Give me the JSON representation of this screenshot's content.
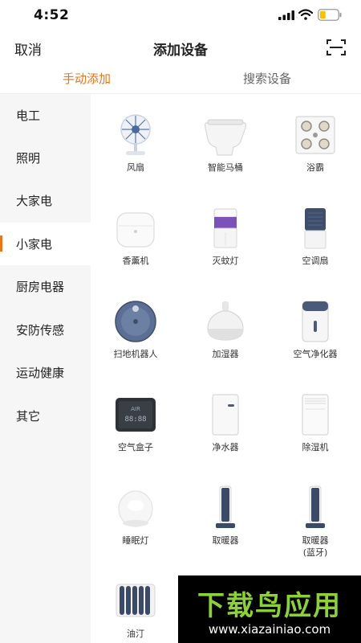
{
  "status_bar": {
    "time": "4:52"
  },
  "nav": {
    "cancel": "取消",
    "title": "添加设备",
    "scan_icon": "scan-icon"
  },
  "tabs": [
    {
      "label": "手动添加",
      "active": true
    },
    {
      "label": "搜索设备",
      "active": false
    }
  ],
  "accent_color": "#e8751a",
  "sidebar": {
    "items": [
      {
        "label": "电工",
        "active": false
      },
      {
        "label": "照明",
        "active": false
      },
      {
        "label": "大家电",
        "active": false
      },
      {
        "label": "小家电",
        "active": true
      },
      {
        "label": "厨房电器",
        "active": false
      },
      {
        "label": "安防传感",
        "active": false
      },
      {
        "label": "运动健康",
        "active": false
      },
      {
        "label": "其它",
        "active": false
      }
    ]
  },
  "devices": [
    {
      "label": "风扇",
      "icon": "fan-icon"
    },
    {
      "label": "智能马桶",
      "icon": "toilet-icon"
    },
    {
      "label": "浴霸",
      "icon": "bath-heater-icon"
    },
    {
      "label": "香薰机",
      "icon": "aroma-diffuser-icon"
    },
    {
      "label": "灭蚊灯",
      "icon": "mosquito-lamp-icon"
    },
    {
      "label": "空调扇",
      "icon": "air-cooler-icon"
    },
    {
      "label": "扫地机器人",
      "icon": "robot-vacuum-icon"
    },
    {
      "label": "加湿器",
      "icon": "humidifier-icon"
    },
    {
      "label": "空气净化器",
      "icon": "air-purifier-icon"
    },
    {
      "label": "空气盒子",
      "icon": "air-box-icon"
    },
    {
      "label": "净水器",
      "icon": "water-purifier-icon"
    },
    {
      "label": "除湿机",
      "icon": "dehumidifier-icon"
    },
    {
      "label": "睡眠灯",
      "icon": "sleep-lamp-icon"
    },
    {
      "label": "取暖器",
      "icon": "heater-icon"
    },
    {
      "label": "取暖器\n(蓝牙)",
      "icon": "heater-bluetooth-icon"
    },
    {
      "label": "油汀",
      "icon": "oil-heater-icon"
    }
  ],
  "air_box_display": {
    "line1": "AIR",
    "line2": "88:88"
  },
  "watermark": {
    "brand": "下载鸟应用",
    "url": "www.xiazainiao.com"
  }
}
